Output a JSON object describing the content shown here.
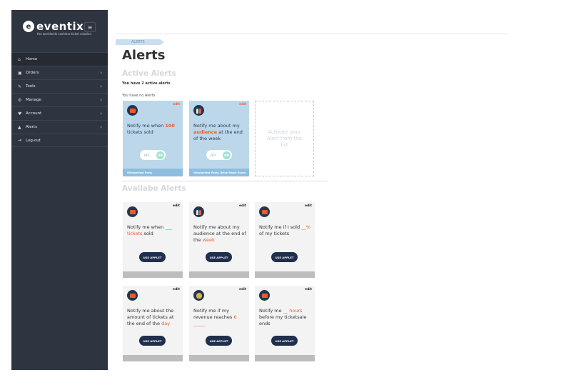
{
  "brand": {
    "name": "eventix",
    "logo": "e",
    "tagline": "the worldwide cashless ticket solution"
  },
  "sidebar": {
    "items": [
      {
        "label": "Home",
        "icon": "home-icon",
        "glyph": "⌂",
        "chevron": ""
      },
      {
        "label": "Orders",
        "icon": "orders-icon",
        "glyph": "▣",
        "chevron": "›"
      },
      {
        "label": "Tools",
        "icon": "wrench-icon",
        "glyph": "✎",
        "chevron": "›"
      },
      {
        "label": "Manage",
        "icon": "gears-icon",
        "glyph": "⚙",
        "chevron": "›"
      },
      {
        "label": "Account",
        "icon": "heart-icon",
        "glyph": "♥",
        "chevron": "›"
      },
      {
        "label": "Alerts",
        "icon": "bell-icon",
        "glyph": "▲",
        "chevron": "›"
      },
      {
        "label": "Log-out",
        "icon": "logout-icon",
        "glyph": "⇥",
        "chevron": ""
      }
    ]
  },
  "breadcrumb": "ALERTS",
  "page_title": "Alerts",
  "active": {
    "title": "Active Alerts",
    "count_text": "You have 2 active alerts",
    "note": "You have no Alerts",
    "cards": [
      {
        "edit": "edit",
        "pre": "Notify me when ",
        "hl": "100",
        "post": " tickets sold",
        "toggle_off": "OFF",
        "toggle_on": "ON",
        "footer": "Oktoberfest Party"
      },
      {
        "edit": "edit",
        "pre": "Notify me about my ",
        "hl": "audience",
        "post": " at the end of the week",
        "toggle_off": "OFF",
        "toggle_on": "ON",
        "footer": "Oktoberfest Party, Drive Music Event"
      }
    ],
    "placeholder": "Activate your Alert from the list"
  },
  "available": {
    "title": "Availabe Alerts",
    "cards": [
      {
        "edit": "edit",
        "pre": "Notify me when ",
        "hl": "___ tickets",
        "post": " sold",
        "button": "USE APPLET"
      },
      {
        "edit": "edit",
        "pre": "Notify me about my audience at the end of the ",
        "hl": "week",
        "post": "",
        "button": "USE APPLET"
      },
      {
        "edit": "edit",
        "pre": "Notify me if I sold ",
        "hl": "__%",
        "post": " of my tickets",
        "button": "USE APPLET"
      },
      {
        "edit": "edit",
        "pre": "Notify me about the amount of tickets at the end of the ",
        "hl": "day",
        "post": "",
        "button": "USE APPLET"
      },
      {
        "edit": "edit",
        "pre": "Notify me if my revenue reaches ",
        "hl": "€ _____",
        "post": "",
        "button": "USE APPLET"
      },
      {
        "edit": "edit",
        "pre": "Notify me ",
        "hl": "__ hours",
        "post": " before my ticketsale ends",
        "button": "USE APPLET"
      }
    ]
  }
}
